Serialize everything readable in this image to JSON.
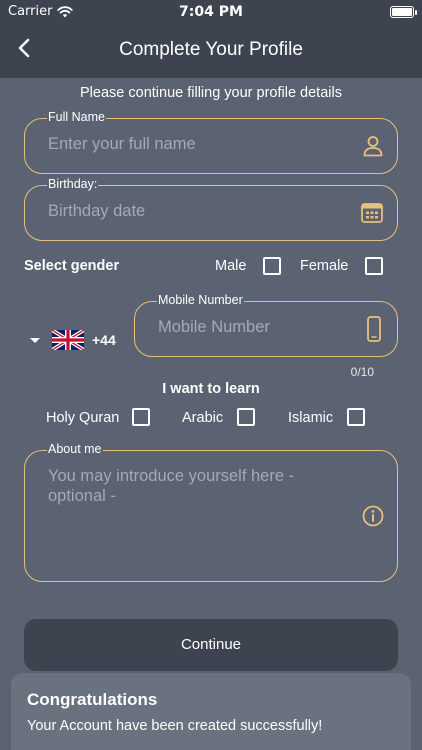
{
  "status_bar": {
    "carrier": "Carrier",
    "time": "7:04 PM"
  },
  "header": {
    "title": "Complete Your Profile"
  },
  "subtitle": "Please continue filling your profile details",
  "full_name": {
    "label": "Full Name",
    "placeholder": "Enter your full name",
    "icon": "person-icon"
  },
  "birthday": {
    "label": "Birthday:",
    "placeholder": "Birthday date",
    "icon": "calendar-icon"
  },
  "gender": {
    "label": "Select gender",
    "options": [
      "Male",
      "Female"
    ]
  },
  "mobile": {
    "country_code": "+44",
    "flag": "uk-flag-icon",
    "label": "Mobile Number",
    "placeholder": "Mobile Number",
    "counter": "0/10",
    "icon": "phone-icon"
  },
  "learn": {
    "label": "I want to learn",
    "options": [
      "Holy Quran",
      "Arabic",
      "Islamic"
    ]
  },
  "about": {
    "label": "About me",
    "placeholder": "You may introduce yourself here - optional -",
    "icon": "info-icon"
  },
  "continue_label": "Continue",
  "toast": {
    "title": "Congratulations",
    "message": "Your Account have been created successfully!"
  },
  "colors": {
    "background": "#5b6271",
    "header": "#3e4350",
    "accent": "#e7c07e",
    "placeholder": "#a4a9b3",
    "toast": "#6a717f"
  }
}
